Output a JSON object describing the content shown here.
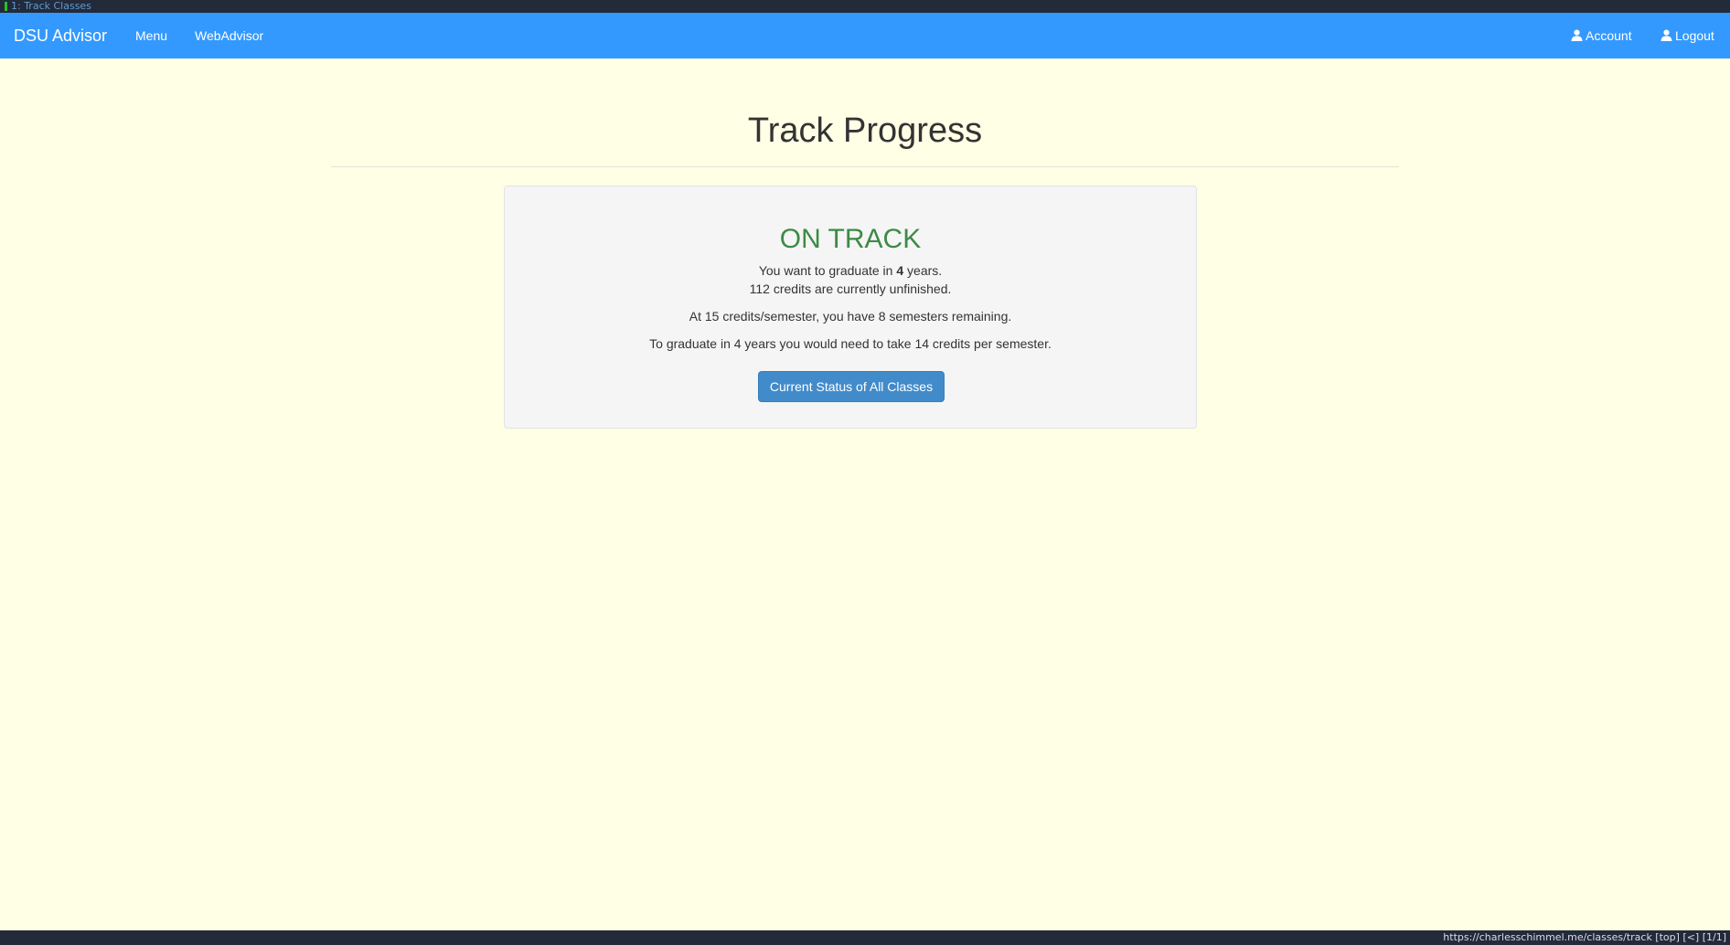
{
  "browser": {
    "tab_label": "1: Track Classes",
    "status_text": "https://charlesschimmel.me/classes/track  [top]  [<]  [1/1]"
  },
  "navbar": {
    "brand": "DSU Advisor",
    "menu_label": "Menu",
    "webadvisor_label": "WebAdvisor",
    "account_label": "Account",
    "logout_label": "Logout",
    "bg_color": "#3399ff"
  },
  "page": {
    "title": "Track Progress"
  },
  "progress": {
    "status": "ON TRACK",
    "status_color": "#3c8a47",
    "graduate_prefix": "You want to graduate in ",
    "graduate_years": "4",
    "graduate_suffix": " years.",
    "credits_unfinished": "112 credits are currently unfinished.",
    "semesters_remaining": "At 15 credits/semester, you have 8 semesters remaining.",
    "needed_credits": "To graduate in 4 years you would need to take 14 credits per semester.",
    "button_label": "Current Status of All Classes"
  },
  "icons": {
    "account": "user-icon",
    "logout": "user-icon"
  }
}
